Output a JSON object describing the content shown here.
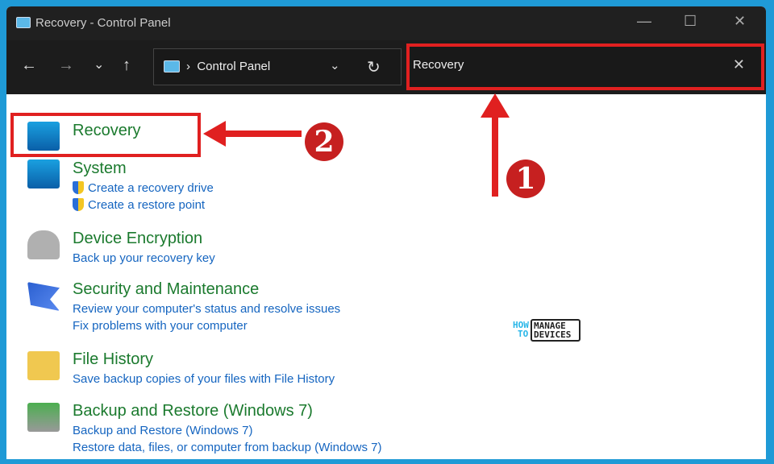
{
  "window": {
    "title": "Recovery - Control Panel",
    "minimize": "—",
    "maximize": "☐",
    "close": "✕"
  },
  "nav": {
    "back": "←",
    "forward": "→",
    "recent": "⌄",
    "up": "↑",
    "address": "Control Panel",
    "separator": "›",
    "dropdown": "⌄",
    "refresh": "↻"
  },
  "search": {
    "value": "Recovery",
    "clear": "✕"
  },
  "results": [
    {
      "title": "Recovery",
      "links": []
    },
    {
      "title": "System",
      "links": [
        "Create a recovery drive",
        "Create a restore point"
      ]
    },
    {
      "title": "Device Encryption",
      "links": [
        "Back up your recovery key"
      ]
    },
    {
      "title": "Security and Maintenance",
      "links": [
        "Review your computer's status and resolve issues",
        "Fix problems with your computer"
      ]
    },
    {
      "title": "File History",
      "links": [
        "Save backup copies of your files with File History"
      ]
    },
    {
      "title": "Backup and Restore (Windows 7)",
      "links": [
        "Backup and Restore (Windows 7)",
        "Restore data, files, or computer from backup (Windows 7)"
      ]
    }
  ],
  "annotations": {
    "step1": "1",
    "step2": "2",
    "color": "#e02020"
  },
  "watermark": {
    "how": "HOW",
    "to": "TO",
    "manage": "MANAGE",
    "devices": "DEVICES"
  }
}
